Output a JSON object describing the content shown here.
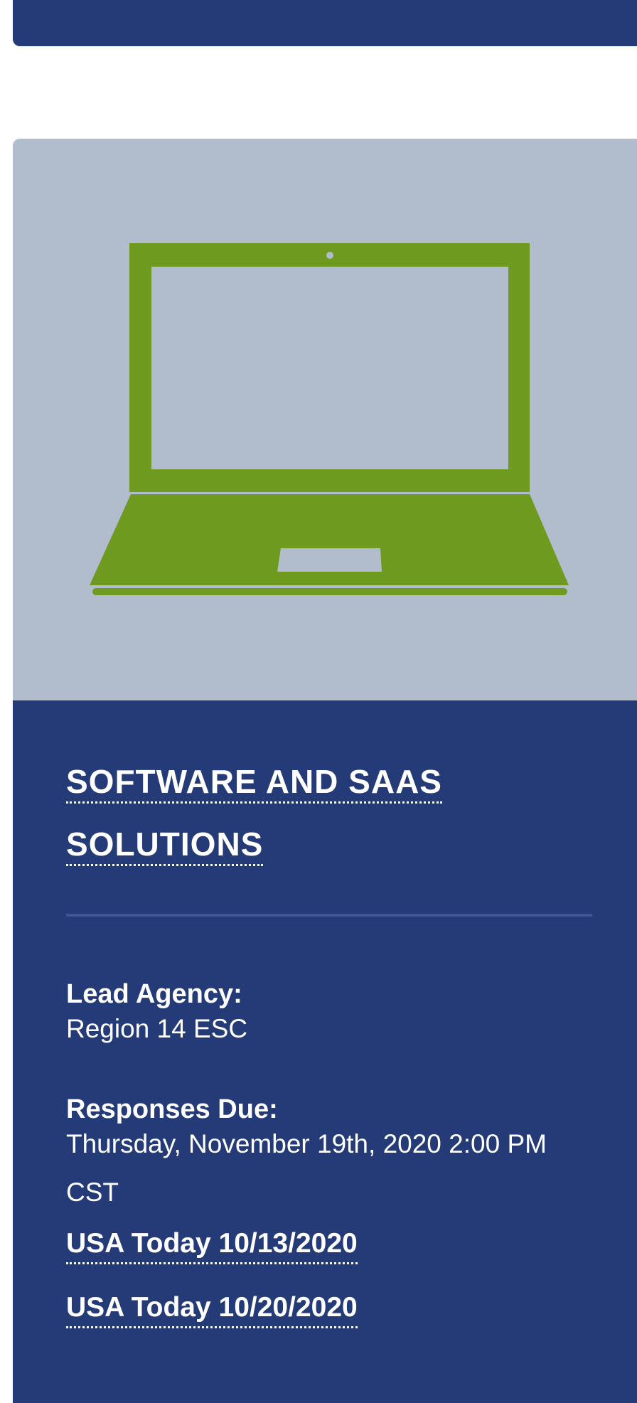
{
  "card": {
    "title": "SOFTWARE AND SAAS SOLUTIONS",
    "image_icon": "laptop-icon",
    "colors": {
      "header_bg": "#243b77",
      "image_bg": "#b1bccd",
      "icon_green": "#6f9a20"
    },
    "fields": [
      {
        "label": "Lead Agency:",
        "value": "Region 14 ESC"
      },
      {
        "label": "Responses Due:",
        "value": "Thursday, November 19th, 2020 2:00 PM CST"
      }
    ],
    "links": [
      {
        "label": "USA Today 10/13/2020"
      },
      {
        "label": "USA Today 10/20/2020"
      }
    ]
  }
}
